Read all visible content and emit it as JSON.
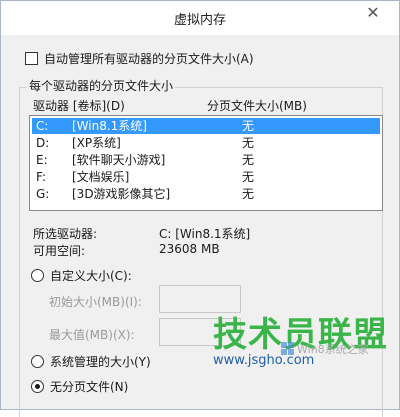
{
  "window": {
    "title": "虚拟内存",
    "close_glyph": "✕"
  },
  "auto_manage": {
    "label": "自动管理所有驱动器的分页文件大小(A)",
    "checked": false
  },
  "group": {
    "title": "每个驱动器的分页文件大小",
    "col_drive": "驱动器 [卷标](D)",
    "col_size": "分页文件大小(MB)"
  },
  "drives": [
    {
      "letter": "C:",
      "label": "[Win8.1系统]",
      "size": "无",
      "selected": true
    },
    {
      "letter": "D:",
      "label": "[XP系统]",
      "size": "无",
      "selected": false
    },
    {
      "letter": "E:",
      "label": "[软件聊天小游戏]",
      "size": "无",
      "selected": false
    },
    {
      "letter": "F:",
      "label": "[文档娱乐]",
      "size": "无",
      "selected": false
    },
    {
      "letter": "G:",
      "label": "[3D游戏影像其它]",
      "size": "无",
      "selected": false
    }
  ],
  "info": {
    "selected_label": "所选驱动器:",
    "selected_value": "C:  [Win8.1系统]",
    "space_label": "可用空间:",
    "space_value": "23608 MB"
  },
  "options": {
    "custom_label": "自定义大小(C):",
    "initial_label": "初始大小(MB)(I):",
    "max_label": "最大值(MB)(X):",
    "system_label": "系统管理的大小(Y)",
    "nopage_label": "无分页文件(N)",
    "selected": "nopage"
  },
  "watermark": {
    "brand": "技术员联盟",
    "url": "www.jsgho.com",
    "system": "Win8系统之家"
  }
}
